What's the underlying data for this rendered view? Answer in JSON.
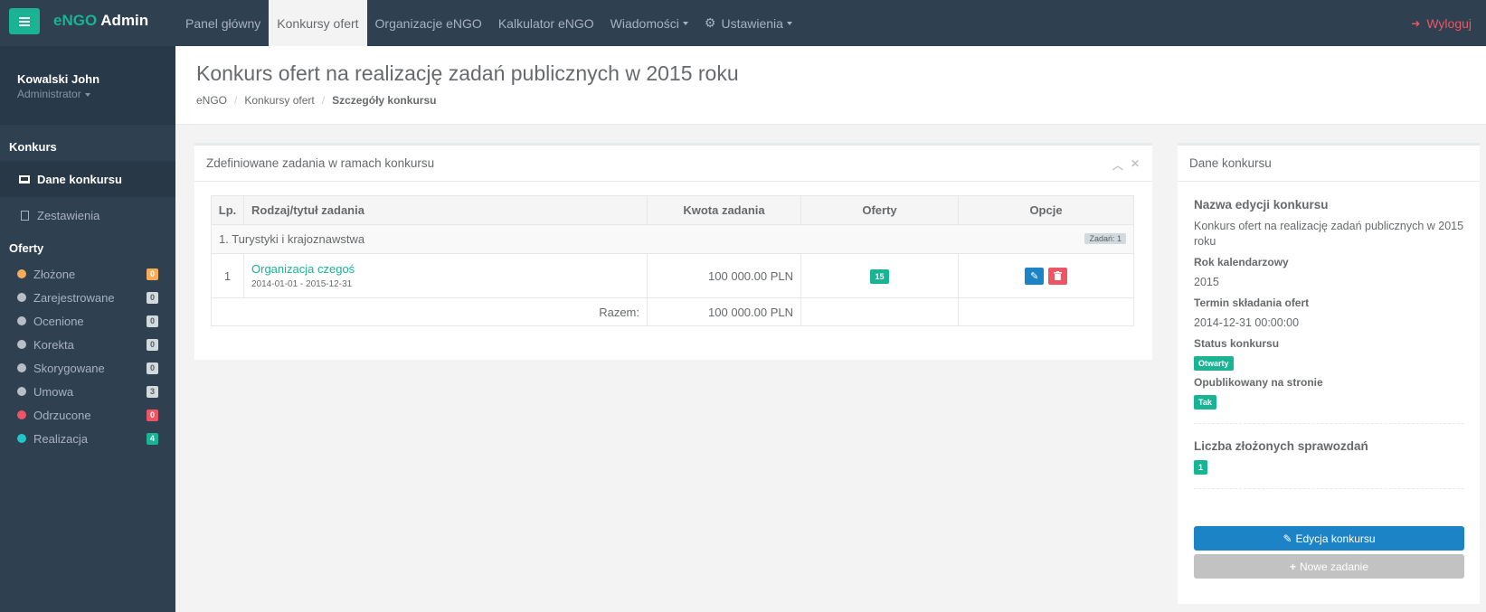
{
  "brand": {
    "accent": "eNGO",
    "main": "Admin"
  },
  "nav": {
    "items": [
      "Panel główny",
      "Konkursy ofert",
      "Organizacje eNGO",
      "Kalkulator eNGO"
    ],
    "messages": "Wiadomości",
    "settings": "Ustawienia",
    "logout": "Wyloguj"
  },
  "user": {
    "name": "Kowalski John",
    "role": "Administrator"
  },
  "sidebar": {
    "section_contest": "Konkurs",
    "item_details": "Dane konkursu",
    "item_reports": "Zestawienia",
    "section_offers": "Oferty",
    "statuses": [
      {
        "label": "Złożone",
        "count": "0",
        "dot": "#f8ac59",
        "badge": "#f8ac59"
      },
      {
        "label": "Zarejestrowane",
        "count": "0",
        "dot": "#b8bec6",
        "badge": "#d1dade"
      },
      {
        "label": "Ocenione",
        "count": "0",
        "dot": "#b8bec6",
        "badge": "#d1dade"
      },
      {
        "label": "Korekta",
        "count": "0",
        "dot": "#b8bec6",
        "badge": "#d1dade"
      },
      {
        "label": "Skorygowane",
        "count": "0",
        "dot": "#b8bec6",
        "badge": "#d1dade"
      },
      {
        "label": "Umowa",
        "count": "3",
        "dot": "#b8bec6",
        "badge": "#d1dade"
      },
      {
        "label": "Odrzucone",
        "count": "0",
        "dot": "#ed5565",
        "badge": "#ed5565"
      },
      {
        "label": "Realizacja",
        "count": "4",
        "dot": "#23c6c8",
        "badge": "#1ab394"
      }
    ]
  },
  "page": {
    "title": "Konkurs ofert na realizację zadań publicznych w 2015 roku",
    "breadcrumb": [
      "eNGO",
      "Konkursy ofert",
      "Szczegóły konkursu"
    ]
  },
  "tasks_panel": {
    "title": "Zdefiniowane zadania w ramach konkursu",
    "columns": [
      "Lp.",
      "Rodzaj/tytuł zadania",
      "Kwota zadania",
      "Oferty",
      "Opcje"
    ],
    "group": {
      "name": "1. Turystyki i krajoznawstwa",
      "tag": "Zadań: 1"
    },
    "task": {
      "lp": "1",
      "name": "Organizacja czegoś",
      "dates": "2014-01-01 - 2015-12-31",
      "amount": "100 000.00 PLN",
      "offers": "15"
    },
    "sum_label": "Razem:",
    "sum_amount": "100 000.00 PLN"
  },
  "details_panel": {
    "title": "Dane konkursu",
    "edition_label": "Nazwa edycji konkursu",
    "edition_value": "Konkurs ofert na realizację zadań publicznych w 2015 roku",
    "year_label": "Rok kalendarzowy",
    "year_value": "2015",
    "deadline_label": "Termin składania ofert",
    "deadline_value": "2014-12-31 00:00:00",
    "status_label": "Status konkursu",
    "status_value": "Otwarty",
    "published_label": "Opublikowany na stronie",
    "published_value": "Tak",
    "reports_label": "Liczba złożonych sprawozdań",
    "reports_value": "1",
    "edit_button": "Edycja konkursu",
    "new_task_button": "Nowe zadanie"
  },
  "colors": {
    "accent": "#1ab394",
    "sidebar": "#2f4050",
    "primary": "#1c84c6",
    "danger": "#ed5565"
  }
}
